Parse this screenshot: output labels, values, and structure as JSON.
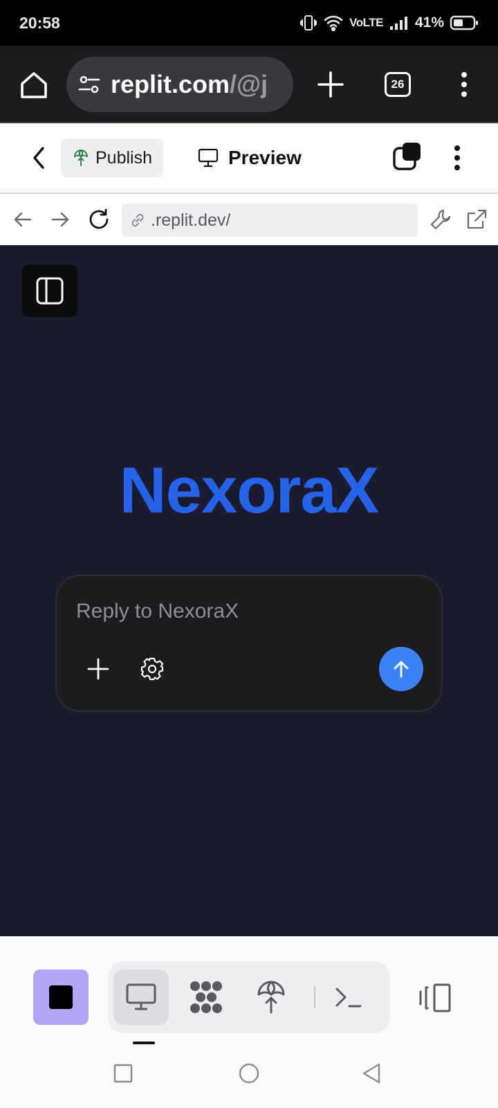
{
  "status": {
    "time": "20:58",
    "network": "VoLTE",
    "battery": "41%"
  },
  "browser": {
    "url_main": "replit.com",
    "url_dim": "/@j",
    "tab_count": "26"
  },
  "replit_toolbar": {
    "publish_label": "Publish",
    "preview_label": "Preview"
  },
  "webview": {
    "url": ".replit.dev/"
  },
  "app": {
    "title": "NexoraX",
    "input_placeholder": "Reply to NexoraX",
    "accent_color": "#2563eb",
    "send_color": "#3b82f6"
  },
  "bottom_toolbar": {
    "active_tool": "preview",
    "tools": [
      "preview-icon",
      "agent-icon",
      "publish-icon",
      "shell-icon"
    ],
    "stop_color": "#b3a4f6"
  }
}
